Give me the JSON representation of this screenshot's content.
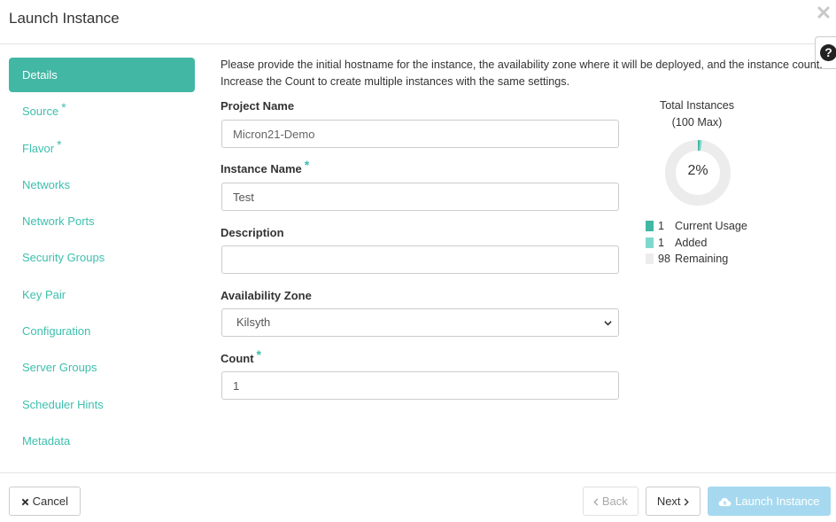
{
  "modal": {
    "title": "Launch Instance"
  },
  "nav": {
    "items": [
      {
        "label": "Details",
        "required": false,
        "active": true
      },
      {
        "label": "Source",
        "required": true
      },
      {
        "label": "Flavor",
        "required": true
      },
      {
        "label": "Networks",
        "required": false
      },
      {
        "label": "Network Ports",
        "required": false
      },
      {
        "label": "Security Groups",
        "required": false
      },
      {
        "label": "Key Pair",
        "required": false
      },
      {
        "label": "Configuration",
        "required": false
      },
      {
        "label": "Server Groups",
        "required": false
      },
      {
        "label": "Scheduler Hints",
        "required": false
      },
      {
        "label": "Metadata",
        "required": false
      }
    ],
    "required_mark": "*"
  },
  "form": {
    "intro": "Please provide the initial hostname for the instance, the availability zone where it will be deployed, and the instance count. Increase the Count to create multiple instances with the same settings.",
    "project_name": {
      "label": "Project Name",
      "value": "Micron21-Demo"
    },
    "instance_name": {
      "label": "Instance Name",
      "value": "Test"
    },
    "description": {
      "label": "Description",
      "value": ""
    },
    "availability_zone": {
      "label": "Availability Zone",
      "value": "Kilsyth"
    },
    "count": {
      "label": "Count",
      "value": "1"
    }
  },
  "quota": {
    "title_line1": "Total Instances",
    "title_line2": "(100 Max)",
    "percent_label": "2%",
    "max": 100,
    "legend": [
      {
        "value": "1",
        "label": "Current Usage",
        "color": "#41b7a4"
      },
      {
        "value": "1",
        "label": "Added",
        "color": "#7fd8ce"
      },
      {
        "value": "98",
        "label": "Remaining",
        "color": "#ececec"
      }
    ]
  },
  "footer": {
    "cancel_label": "Cancel",
    "back_label": "Back",
    "next_label": "Next",
    "launch_label": "Launch Instance"
  },
  "colors": {
    "accent": "#41b7a4",
    "link": "#3cbfae",
    "launch_disabled": "#a6d9ef"
  }
}
